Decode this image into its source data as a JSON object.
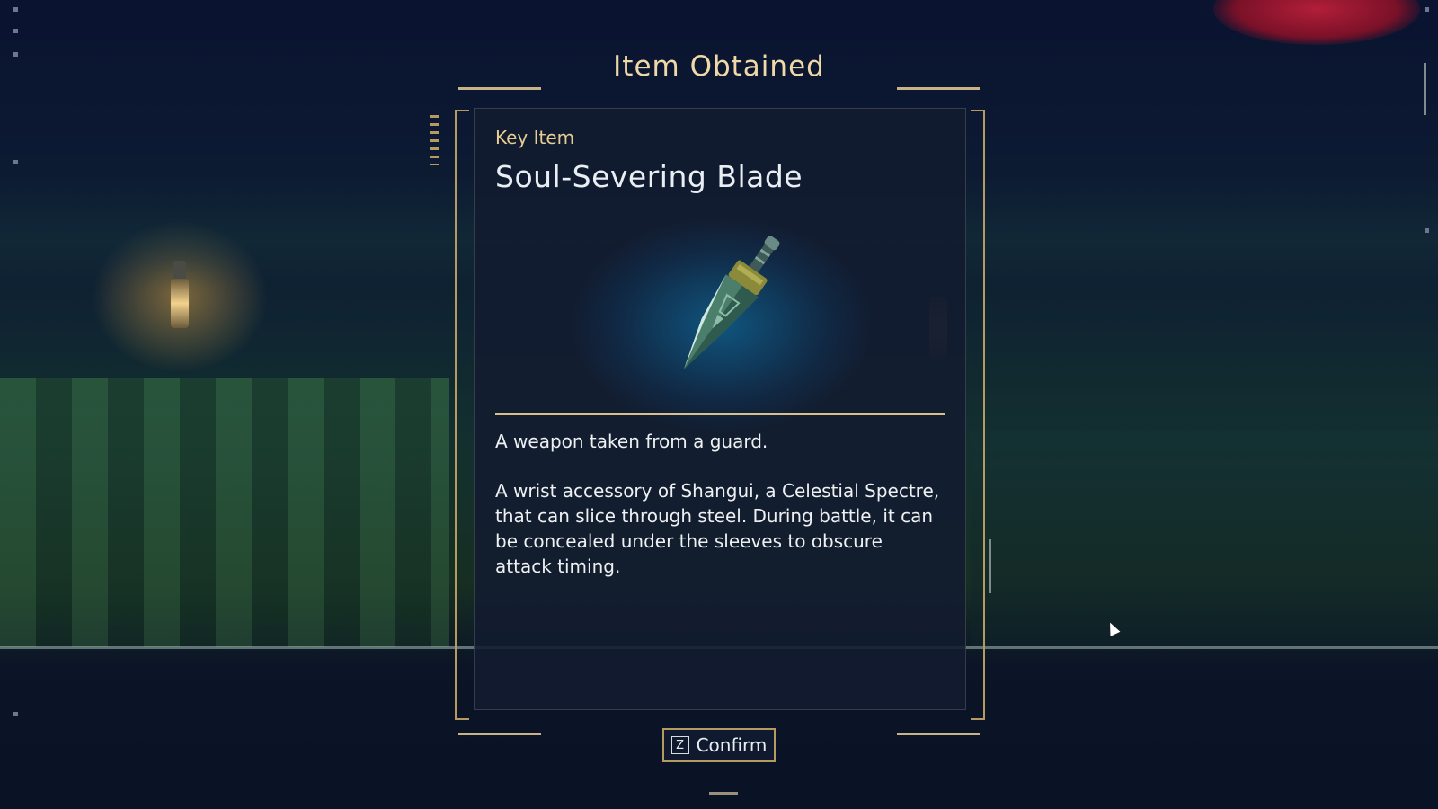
{
  "dialog": {
    "title": "Item Obtained",
    "category": "Key Item",
    "item_name": "Soul-Severing Blade",
    "item_icon": "dagger-icon",
    "description_short": "A weapon taken from a guard.",
    "description_long": "A wrist accessory of Shangui, a Celestial Spectre, that can slice through steel. During battle, it can be concealed under the sleeves to obscure attack timing."
  },
  "confirm": {
    "key": "Z",
    "label": "Confirm"
  },
  "colors": {
    "accent_gold": "#c9b285",
    "title_text": "#efd9a8",
    "panel_bg": "#121b30",
    "glow_blue": "#0f5f8c"
  }
}
